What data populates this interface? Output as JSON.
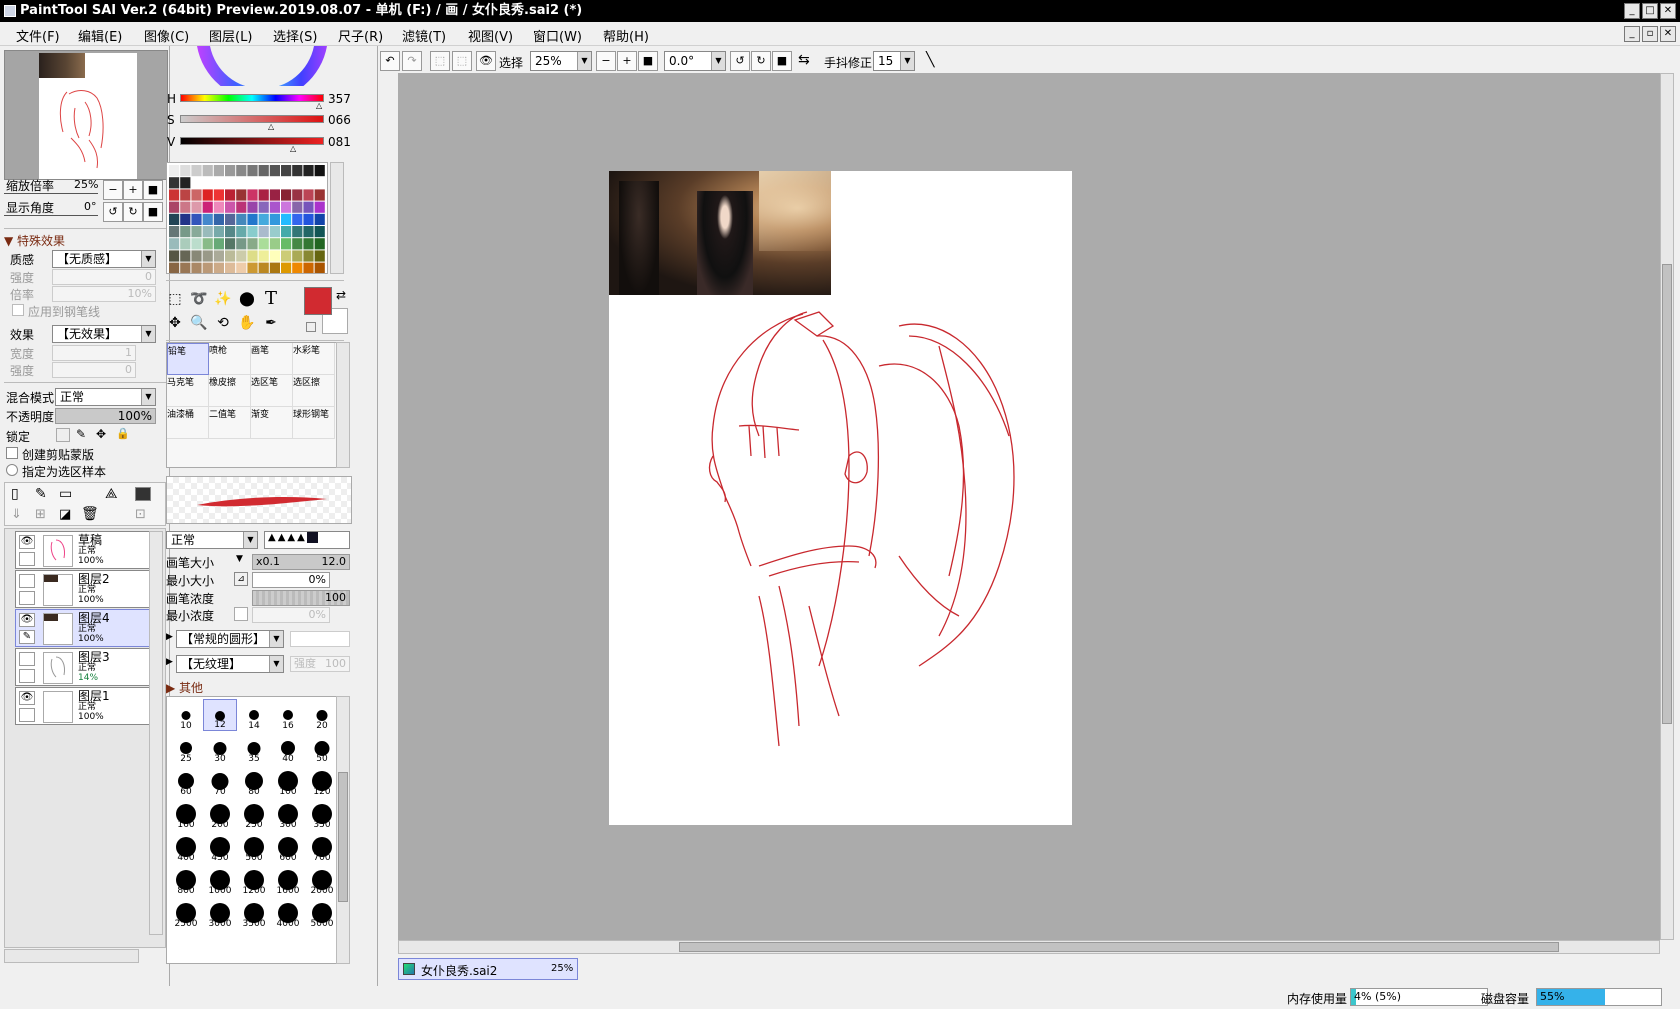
{
  "window": {
    "title": "PaintTool SAI Ver.2 (64bit) Preview.2019.08.07 - 单机 (F:) / 画 / 女仆良秀.sai2 (*)",
    "minimize": "_",
    "maximize": "□",
    "close": "✕"
  },
  "menu": [
    "文件(F)",
    "编辑(E)",
    "图像(C)",
    "图层(L)",
    "选择(S)",
    "尺子(R)",
    "滤镜(T)",
    "视图(V)",
    "窗口(W)",
    "帮助(H)"
  ],
  "navigator": {
    "zoom_label": "缩放倍率",
    "zoom_value": "25%",
    "angle_label": "显示角度",
    "angle_value": "0°"
  },
  "effects": {
    "section_title": "特殊效果",
    "texture_label": "质感",
    "texture_value": "【无质感】",
    "strength_label": "强度",
    "strength_value": "0",
    "scale_label": "倍率",
    "scale_value": "10%",
    "apply_pen_label": "应用到钢笔线",
    "effect_label": "效果",
    "effect_value": "【无效果】",
    "width_label": "宽度",
    "width_value": "1",
    "strength2_label": "强度",
    "strength2_value": "0"
  },
  "layer_props": {
    "blend_label": "混合模式",
    "blend_value": "正常",
    "opacity_label": "不透明度",
    "opacity_value": "100%",
    "lock_label": "锁定",
    "clip_label": "创建剪贴蒙版",
    "sample_label": "指定为选区样本"
  },
  "layers": [
    {
      "name": "草稿",
      "mode": "正常",
      "opacity": "100%",
      "visible": true,
      "selected": false
    },
    {
      "name": "图层2",
      "mode": "正常",
      "opacity": "100%",
      "visible": false,
      "selected": false
    },
    {
      "name": "图层4",
      "mode": "正常",
      "opacity": "100%",
      "visible": true,
      "selected": true
    },
    {
      "name": "图层3",
      "mode": "正常",
      "opacity": "14%",
      "visible": false,
      "selected": false
    },
    {
      "name": "图层1",
      "mode": "正常",
      "opacity": "100%",
      "visible": true,
      "selected": false
    }
  ],
  "color": {
    "h_label": "H",
    "h_value": "357",
    "s_label": "S",
    "s_value": "066",
    "v_label": "V",
    "v_value": "081",
    "foreground": "#d12a30",
    "background": "#ffffff"
  },
  "brushes": [
    "铅笔",
    "喷枪",
    "画笔",
    "水彩笔",
    "马克笔",
    "橡皮擦",
    "选区笔",
    "选区擦",
    "油漆桶",
    "二值笔",
    "渐变",
    "球形钢笔"
  ],
  "brush_settings": {
    "mode_value": "正常",
    "size_label": "画笔大小",
    "size_mult": "x0.1",
    "size_value": "12.0",
    "min_size_label": "最小大小",
    "min_size_value": "0%",
    "density_label": "画笔浓度",
    "density_value": "100",
    "min_density_label": "最小浓度",
    "min_density_value": "0%",
    "shape_value": "【常规的圆形】",
    "texture_value": "【无纹理】",
    "texture_strength": "强度",
    "texture_strength_value": "100",
    "other_label": "其他"
  },
  "brush_sizes": [
    "10",
    "12",
    "14",
    "16",
    "20",
    "25",
    "30",
    "35",
    "40",
    "50",
    "60",
    "70",
    "80",
    "100",
    "120",
    "160",
    "200",
    "250",
    "300",
    "350",
    "400",
    "450",
    "500",
    "600",
    "700",
    "800",
    "1000",
    "1200",
    "1600",
    "2000",
    "2500",
    "3000",
    "3500",
    "4000",
    "5000"
  ],
  "toolbar": {
    "selection_label": "选择",
    "zoom_value": "25%",
    "angle_value": "0.0°",
    "stabilizer_label": "手抖修正",
    "stabilizer_value": "15"
  },
  "document_tab": {
    "name": "女仆良秀.sai2",
    "zoom": "25%"
  },
  "status": {
    "memory_label": "内存使用量",
    "memory_value": "4% (5%)",
    "memory_fill": 4,
    "disk_label": "磁盘容量",
    "disk_value": "55%",
    "disk_fill": 55
  }
}
